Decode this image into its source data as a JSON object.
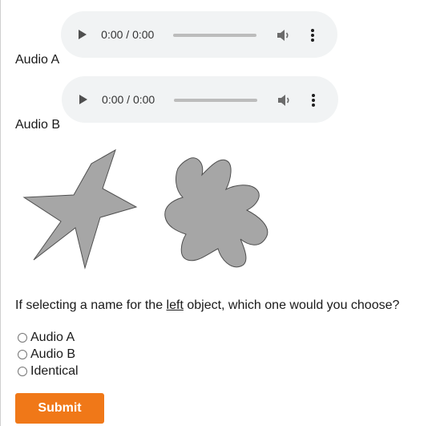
{
  "audio_players": [
    {
      "label": "Audio A",
      "time": "0:00 / 0:00"
    },
    {
      "label": "Audio B",
      "time": "0:00 / 0:00"
    }
  ],
  "shapes": {
    "left": {
      "icon": "spiky-star-shape",
      "fill": "#a6a6a6"
    },
    "right": {
      "icon": "rounded-blob-shape",
      "fill": "#a6a6a6"
    }
  },
  "question": {
    "before": "If selecting a name for the ",
    "emphasis": "left",
    "after": " object, which one would you choose?"
  },
  "options": [
    "Audio A",
    "Audio B",
    "Identical"
  ],
  "submit_label": "Submit",
  "colors": {
    "accent": "#f07818",
    "player_bg": "#f1f3f4",
    "shape_fill": "#a6a6a6"
  }
}
